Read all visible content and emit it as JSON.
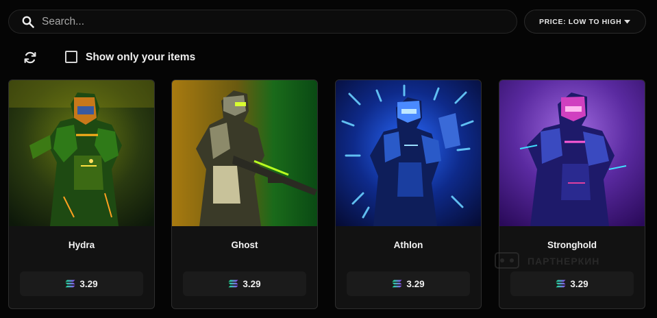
{
  "search": {
    "placeholder": "Search...",
    "value": ""
  },
  "sort": {
    "label": "PRICE: LOW TO HIGH"
  },
  "filters": {
    "show_only_label": "Show only your items",
    "show_only_checked": false
  },
  "items": [
    {
      "name": "Hydra",
      "price": "3.29"
    },
    {
      "name": "Ghost",
      "price": "3.29"
    },
    {
      "name": "Athlon",
      "price": "3.29"
    },
    {
      "name": "Stronghold",
      "price": "3.29"
    }
  ],
  "watermark": {
    "text": "ПАРТНЕРКИН"
  },
  "colors": {
    "background": "#050505",
    "card": "#121212",
    "price_box": "#1b1b1b",
    "sol_gradient_start": "#14F195",
    "sol_gradient_end": "#9945FF"
  },
  "icons": [
    "search-icon",
    "caret-down-icon",
    "refresh-icon",
    "checkbox",
    "solana-icon"
  ]
}
